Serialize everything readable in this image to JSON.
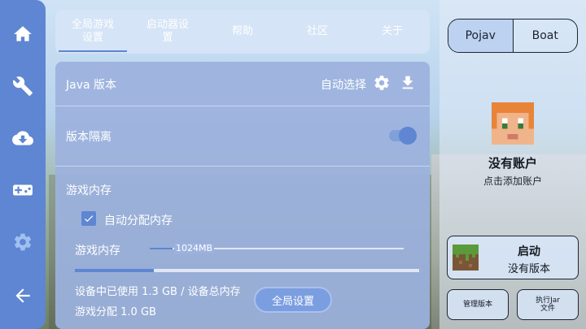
{
  "sidebar": {
    "items": [
      {
        "name": "home-icon"
      },
      {
        "name": "wrench-icon"
      },
      {
        "name": "cloud-download-icon"
      },
      {
        "name": "gamepad-icon"
      },
      {
        "name": "gear-icon",
        "active": true
      },
      {
        "name": "back-arrow-icon"
      }
    ]
  },
  "tabs": [
    {
      "label": "全局游戏\n设置",
      "active": true
    },
    {
      "label": "启动器设\n置"
    },
    {
      "label": "帮助"
    },
    {
      "label": "社区"
    },
    {
      "label": "关于"
    }
  ],
  "settings": {
    "java": {
      "label": "Java 版本",
      "value": "自动选择"
    },
    "isolation": {
      "label": "版本隔离",
      "enabled": true
    },
    "memory": {
      "section_label": "游戏内存",
      "auto_label": "自动分配内存",
      "auto_checked": true,
      "slider_label": "游戏内存",
      "slider_value": "1024MB",
      "used_text": "设备中已使用 1.3 GB / 设备总内存",
      "alloc_text": "游戏分配 1.0 GB"
    }
  },
  "floating_button": "全局设置",
  "launcher": {
    "segments": [
      "Pojav",
      "Boat"
    ],
    "active_segment": "Pojav",
    "account_title": "没有账户",
    "account_subtitle": "点击添加账户",
    "launch_title": "启动",
    "launch_subtitle": "没有版本",
    "manage_label": "管理版本",
    "jar_label": "执行Jar\n文件"
  },
  "colors": {
    "accent": "#5e86d2",
    "panel": "#9cb2de"
  }
}
